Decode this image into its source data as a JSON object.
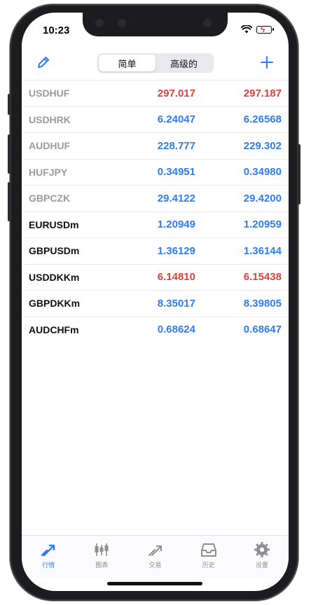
{
  "status_bar": {
    "time": "10:23"
  },
  "segmented": {
    "simple_label": "简单",
    "advanced_label": "高级的",
    "active": "simple"
  },
  "colors": {
    "accent": "#2f7cf6",
    "down": "#e0403a",
    "up": "#2f7cf6",
    "muted": "#9a9aa0"
  },
  "quotes": [
    {
      "symbol": "USDHUF",
      "bid": "297.017",
      "ask": "297.187",
      "direction": "down",
      "style": "dim"
    },
    {
      "symbol": "USDHRK",
      "bid": "6.24047",
      "ask": "6.26568",
      "direction": "up",
      "style": "dim"
    },
    {
      "symbol": "AUDHUF",
      "bid": "228.777",
      "ask": "229.302",
      "direction": "up",
      "style": "dim"
    },
    {
      "symbol": "HUFJPY",
      "bid": "0.34951",
      "ask": "0.34980",
      "direction": "up",
      "style": "dim"
    },
    {
      "symbol": "GBPCZK",
      "bid": "29.4122",
      "ask": "29.4200",
      "direction": "up",
      "style": "dim"
    },
    {
      "symbol": "EURUSDm",
      "bid": "1.20949",
      "ask": "1.20959",
      "direction": "up",
      "style": "dark"
    },
    {
      "symbol": "GBPUSDm",
      "bid": "1.36129",
      "ask": "1.36144",
      "direction": "up",
      "style": "dark"
    },
    {
      "symbol": "USDDKKm",
      "bid": "6.14810",
      "ask": "6.15438",
      "direction": "down",
      "style": "dark"
    },
    {
      "symbol": "GBPDKKm",
      "bid": "8.35017",
      "ask": "8.39805",
      "direction": "up",
      "style": "dark"
    },
    {
      "symbol": "AUDCHFm",
      "bid": "0.68624",
      "ask": "0.68647",
      "direction": "up",
      "style": "dark"
    }
  ],
  "tabs": [
    {
      "label": "行情",
      "icon": "quotes-icon",
      "active": true
    },
    {
      "label": "图表",
      "icon": "chart-icon",
      "active": false
    },
    {
      "label": "交易",
      "icon": "trade-icon",
      "active": false
    },
    {
      "label": "历史",
      "icon": "history-icon",
      "active": false
    },
    {
      "label": "设置",
      "icon": "settings-icon",
      "active": false
    }
  ]
}
